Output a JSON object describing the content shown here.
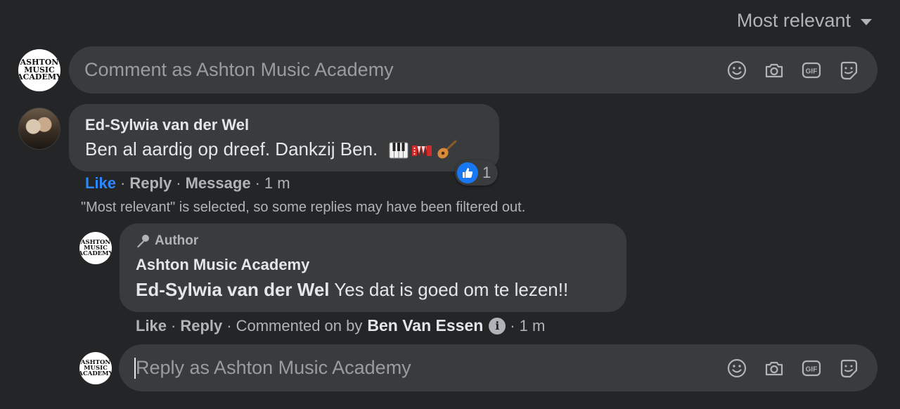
{
  "sort": {
    "label": "Most relevant"
  },
  "page_avatar": {
    "lines": [
      "ASHTON",
      "MUSIC",
      "ACADEMY"
    ]
  },
  "comment_input": {
    "placeholder": "Comment as Ashton Music Academy"
  },
  "input_icons": [
    "emoji-icon",
    "camera-icon",
    "gif-icon",
    "sticker-icon"
  ],
  "comment": {
    "author": "Ed-Sylwia van der Wel",
    "text": "Ben al aardig op dreef. Dankzij Ben.",
    "emojis": [
      "piano-emoji",
      "accordion-emoji",
      "guitar-emoji"
    ],
    "reaction_count": "1",
    "actions": {
      "like": "Like",
      "reply": "Reply",
      "message": "Message",
      "time": "1 m"
    }
  },
  "filter_note": "\"Most relevant\" is selected, so some replies may have been filtered out.",
  "reply": {
    "badge": "Author",
    "author": "Ashton Music Academy",
    "mention": "Ed-Sylwia van der Wel",
    "text": "Yes dat is goed om te lezen!!",
    "actions": {
      "like": "Like",
      "reply": "Reply",
      "commented_on_by": "Commented on by",
      "by_name": "Ben Van Essen",
      "time": "1 m"
    }
  },
  "reply_input": {
    "placeholder": "Reply as Ashton Music Academy"
  },
  "colors": {
    "background": "#242526",
    "bubble": "#3a3b3c",
    "like_blue": "#2d88ff",
    "muted": "#b0b3b8"
  }
}
